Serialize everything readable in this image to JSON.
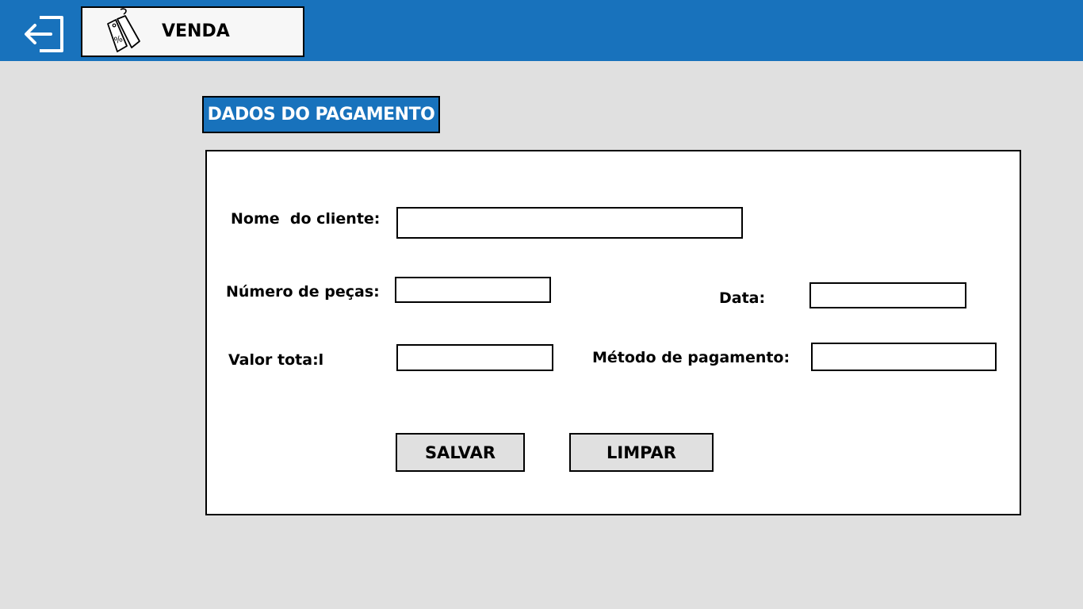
{
  "header": {
    "exit_icon": "exit-arrow-icon",
    "tab": {
      "icon": "price-tag-icon",
      "label": "VENDA"
    }
  },
  "section": {
    "title": "DADOS DO PAGAMENTO"
  },
  "form": {
    "client_name": {
      "label": "Nome  do cliente:",
      "value": ""
    },
    "piece_count": {
      "label": "Número de peças:",
      "value": ""
    },
    "date": {
      "label": "Data:",
      "value": ""
    },
    "total_value": {
      "label": "Valor tota:l",
      "value": ""
    },
    "payment_method": {
      "label": "Método de pagamento:",
      "value": ""
    }
  },
  "buttons": {
    "save": "SALVAR",
    "clear": "LIMPAR"
  },
  "colors": {
    "header_bg": "#1872bc",
    "page_bg": "#e0e0e0",
    "panel_bg": "#ffffff"
  }
}
